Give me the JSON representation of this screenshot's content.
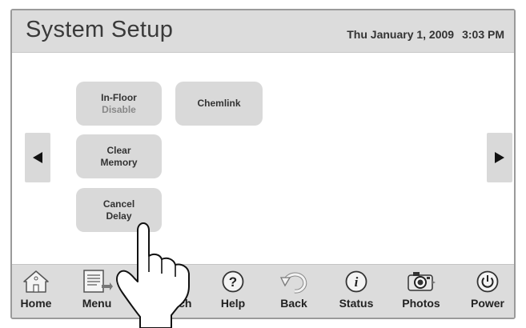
{
  "header": {
    "title": "System Setup",
    "date": "Thu January 1, 2009",
    "time": "3:03 PM"
  },
  "buttons": {
    "infloor": {
      "line1": "In-Floor",
      "line2": "Disable"
    },
    "chemlink": {
      "label": "Chemlink"
    },
    "clear_memory": {
      "line1": "Clear",
      "line2": "Memory"
    },
    "cancel_delay": {
      "line1": "Cancel",
      "line2": "Delay"
    }
  },
  "nav": {
    "home": "Home",
    "menu": "Menu",
    "touch": "Touch",
    "help": "Help",
    "back": "Back",
    "status": "Status",
    "photos": "Photos",
    "power": "Power"
  },
  "icons": {
    "left_arrow": "triangle-left",
    "right_arrow": "triangle-right",
    "home": "house",
    "menu": "document-arrow",
    "help": "question-circle",
    "back": "back-arrow",
    "status": "info-circle",
    "photos": "camera",
    "power": "power-button"
  },
  "colors": {
    "bar_gray": "#dcdcdc",
    "button_gray": "#d9d9d9",
    "text_dark": "#333333"
  }
}
